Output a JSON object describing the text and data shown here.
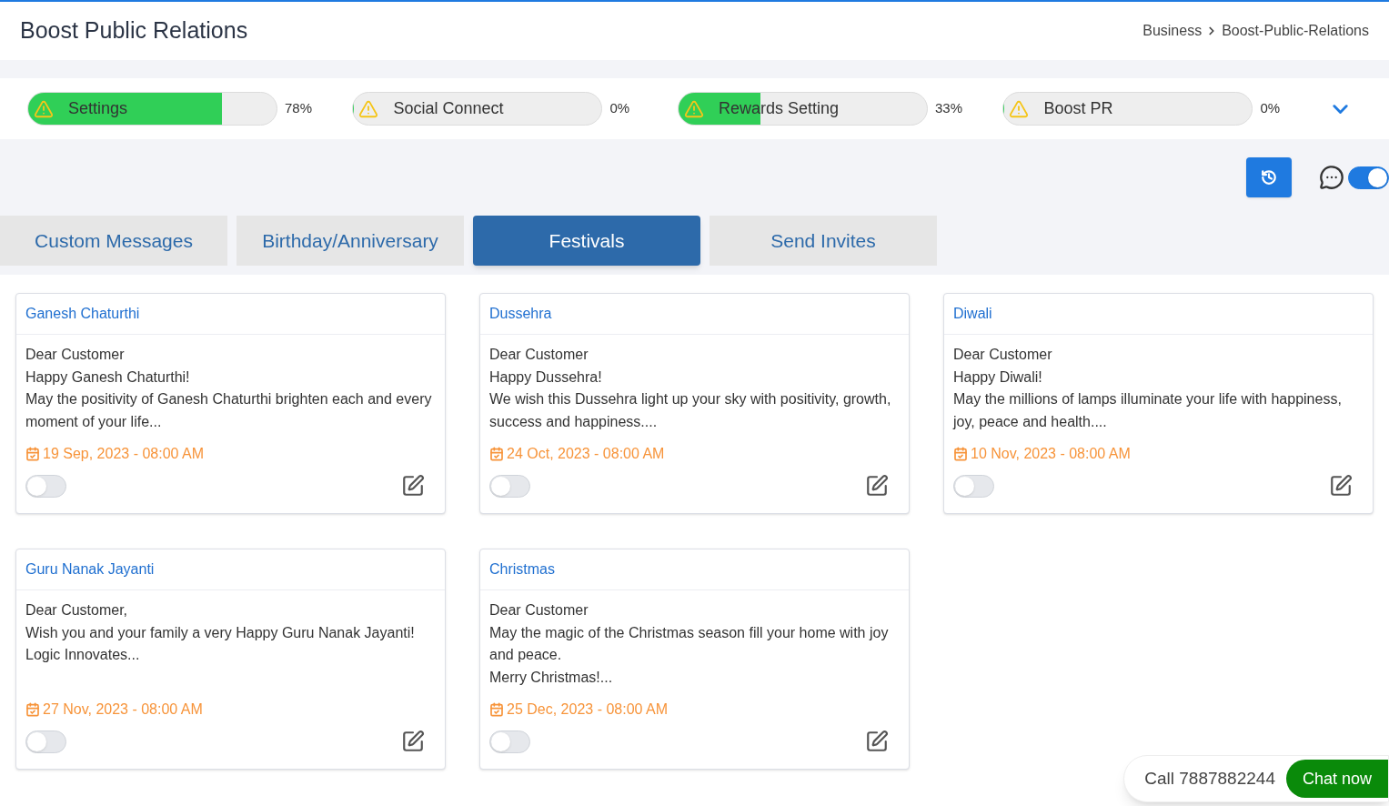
{
  "header": {
    "title": "Boost Public Relations",
    "breadcrumb": [
      "Business",
      "Boost-Public-Relations"
    ]
  },
  "progress": [
    {
      "label": "Settings",
      "level": 0.78,
      "reading": "78%"
    },
    {
      "label": "Social Connect",
      "level": 0,
      "reading": "0%"
    },
    {
      "label": "Rewards Setting",
      "level": 0.33,
      "reading": "33%"
    },
    {
      "label": "Boost PR",
      "level": 0,
      "reading": "0%"
    }
  ],
  "chat_toggle": {
    "on": true
  },
  "tabs": [
    {
      "label": "Custom Messages",
      "selected": false
    },
    {
      "label": "Birthday/Anniversary",
      "selected": false
    },
    {
      "label": "Festivals",
      "selected": true
    },
    {
      "label": "Send Invites",
      "selected": false
    }
  ],
  "cards": [
    {
      "title": "Ganesh Chaturthi",
      "lines": [
        "Dear Customer",
        "Happy Ganesh Chaturthi!",
        "May the positivity of Ganesh Chaturthi brighten each and every moment of your life..."
      ],
      "date": "19 Sep, 2023 - 08:00 AM",
      "on": false
    },
    {
      "title": "Dussehra",
      "lines": [
        "Dear Customer",
        "Happy Dussehra!",
        "We wish this Dussehra light up your sky with positivity, growth, success and happiness...."
      ],
      "date": "24 Oct, 2023 - 08:00 AM",
      "on": false
    },
    {
      "title": "Diwali",
      "lines": [
        "Dear Customer",
        "Happy Diwali!",
        "May the millions of lamps illuminate your life with happiness, joy, peace and health...."
      ],
      "date": "10 Nov, 2023 - 08:00 AM",
      "on": false
    },
    {
      "title": "Guru Nanak Jayanti",
      "lines": [
        "Dear Customer,",
        "Wish you and your family a very Happy Guru Nanak Jayanti!",
        "Logic Innovates..."
      ],
      "date": "27 Nov, 2023 - 08:00 AM",
      "on": false
    },
    {
      "title": "Christmas",
      "lines": [
        "Dear Customer",
        "May the magic of the Christmas season fill your home with joy and peace.",
        "Merry Christmas!..."
      ],
      "date": "25 Dec, 2023 - 08:00 AM",
      "on": false
    }
  ],
  "contact": {
    "call": "Call 7887882244",
    "chat": "Chat now"
  }
}
